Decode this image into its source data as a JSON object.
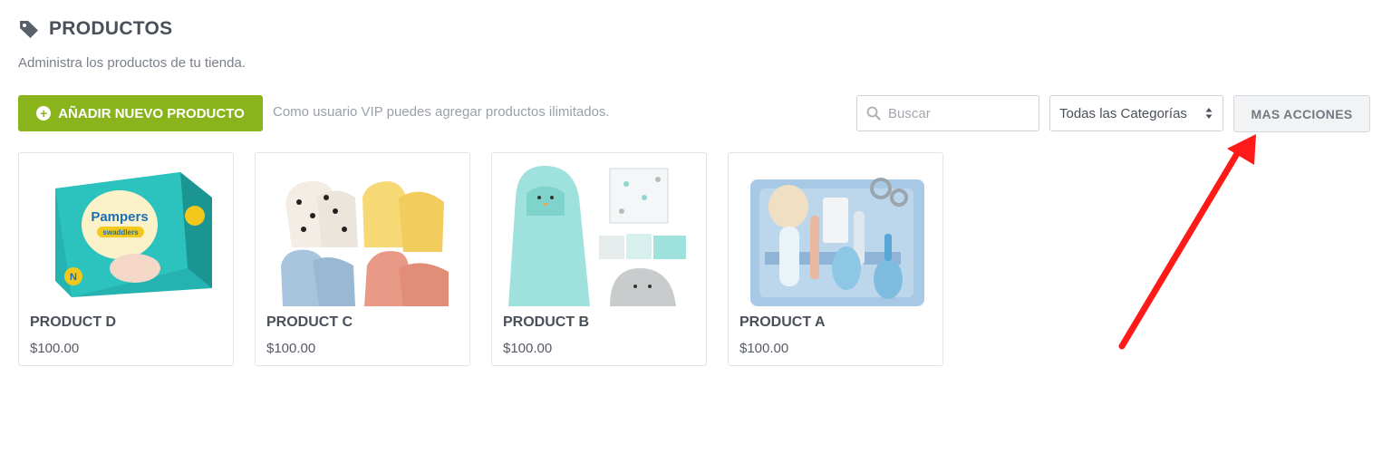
{
  "header": {
    "title": "PRODUCTOS",
    "subtitle": "Administra los productos de tu tienda.",
    "icon": "tag-icon"
  },
  "toolbar": {
    "add_label": "AÑADIR NUEVO PRODUCTO",
    "vip_note": "Como usuario VIP puedes agregar productos ilimitados.",
    "search_placeholder": "Buscar",
    "category_selected": "Todas las Categorías",
    "more_actions_label": "MAS ACCIONES"
  },
  "products": [
    {
      "name": "PRODUCT D",
      "price": "$100.00",
      "image": "diaper-pack"
    },
    {
      "name": "PRODUCT C",
      "price": "$100.00",
      "image": "baby-mittens"
    },
    {
      "name": "PRODUCT B",
      "price": "$100.00",
      "image": "hooded-towel-set"
    },
    {
      "name": "PRODUCT A",
      "price": "$100.00",
      "image": "baby-grooming-kit"
    }
  ],
  "colors": {
    "primary": "#8ab41c",
    "annotation_arrow": "#ff1a1a"
  }
}
